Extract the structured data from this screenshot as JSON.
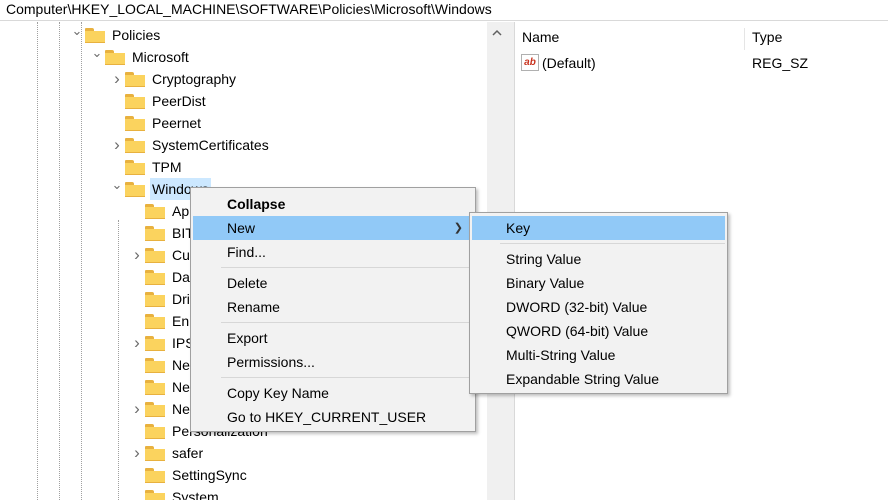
{
  "address_bar": {
    "path": "Computer\\HKEY_LOCAL_MACHINE\\SOFTWARE\\Policies\\Microsoft\\Windows"
  },
  "tree": {
    "nodes": [
      {
        "label": "Policies",
        "twisty": "expanded"
      },
      {
        "label": "Microsoft",
        "twisty": "expanded"
      },
      {
        "label": "Cryptography",
        "twisty": "collapsed"
      },
      {
        "label": "PeerDist",
        "twisty": "none"
      },
      {
        "label": "Peernet",
        "twisty": "none"
      },
      {
        "label": "SystemCertificates",
        "twisty": "collapsed"
      },
      {
        "label": "TPM",
        "twisty": "none"
      },
      {
        "label": "Windows",
        "twisty": "expanded",
        "selected": true
      },
      {
        "label": "Ap",
        "twisty": "none"
      },
      {
        "label": "BIT",
        "twisty": "none"
      },
      {
        "label": "Cur",
        "twisty": "collapsed"
      },
      {
        "label": "Da",
        "twisty": "none"
      },
      {
        "label": "Dri",
        "twisty": "none"
      },
      {
        "label": "Enh",
        "twisty": "none"
      },
      {
        "label": "IPS",
        "twisty": "collapsed"
      },
      {
        "label": "Ne",
        "twisty": "none"
      },
      {
        "label": "Ne",
        "twisty": "none"
      },
      {
        "label": "Ne",
        "twisty": "collapsed"
      },
      {
        "label": "Personalization",
        "twisty": "none"
      },
      {
        "label": "safer",
        "twisty": "collapsed"
      },
      {
        "label": "SettingSync",
        "twisty": "none"
      },
      {
        "label": "System",
        "twisty": "none"
      }
    ],
    "scroll_up_icon": "chevron-up-icon"
  },
  "list": {
    "columns": [
      "Name",
      "Type"
    ],
    "rows": [
      {
        "name": "(Default)",
        "type": "REG_SZ",
        "icon": "ab-string-icon"
      }
    ]
  },
  "context_menu": {
    "items": [
      {
        "label": "Collapse",
        "bold": true
      },
      {
        "label": "New",
        "submenu": true,
        "highlighted": true
      },
      {
        "label": "Find..."
      },
      {
        "label": "Delete"
      },
      {
        "label": "Rename"
      },
      {
        "label": "Export"
      },
      {
        "label": "Permissions..."
      },
      {
        "label": "Copy Key Name"
      },
      {
        "label": "Go to HKEY_CURRENT_USER"
      }
    ]
  },
  "submenu": {
    "items": [
      {
        "label": "Key",
        "highlighted": true
      },
      {
        "label": "String Value"
      },
      {
        "label": "Binary Value"
      },
      {
        "label": "DWORD (32-bit) Value"
      },
      {
        "label": "QWORD (64-bit) Value"
      },
      {
        "label": "Multi-String Value"
      },
      {
        "label": "Expandable String Value"
      }
    ]
  },
  "colors": {
    "selection": "#cce8ff",
    "menu_highlight": "#91c9f7",
    "folder": "#fbd35e"
  }
}
